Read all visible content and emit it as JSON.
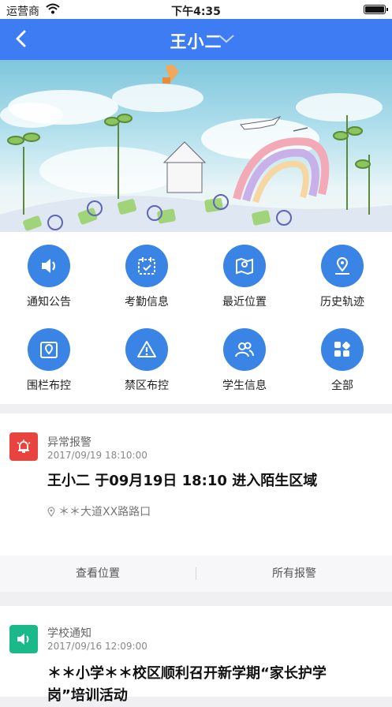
{
  "status_bar": {
    "carrier": "运营商",
    "time": "下午4:35"
  },
  "nav": {
    "title": "王小二"
  },
  "grid": [
    {
      "label": "通知公告",
      "icon": "speaker-icon"
    },
    {
      "label": "考勤信息",
      "icon": "calendar-check-icon"
    },
    {
      "label": "最近位置",
      "icon": "map-pin-icon"
    },
    {
      "label": "历史轨迹",
      "icon": "location-history-icon"
    },
    {
      "label": "围栏布控",
      "icon": "fence-pin-icon"
    },
    {
      "label": "禁区布控",
      "icon": "warning-icon"
    },
    {
      "label": "学生信息",
      "icon": "students-icon"
    },
    {
      "label": "全部",
      "icon": "apps-icon"
    }
  ],
  "alarm_card": {
    "type": "异常报警",
    "date": "2017/09/19 18:10:00",
    "headline": "王小二 于09月19日 18:10 进入陌生区域",
    "location": "＊＊大道XX路路口",
    "badge_color": "#e9433f"
  },
  "actions": {
    "view_location": "查看位置",
    "all_alarms": "所有报警"
  },
  "notice_card": {
    "type": "学校通知",
    "date": "2017/09/16 12:09:00",
    "headline": "＊＊小学＊＊校区顺利召开新学期“家长护学岗”培训活动",
    "badge_color": "#19b98a"
  },
  "colors": {
    "primary": "#3d7cf2",
    "icon_circle": "#3a84e6"
  }
}
